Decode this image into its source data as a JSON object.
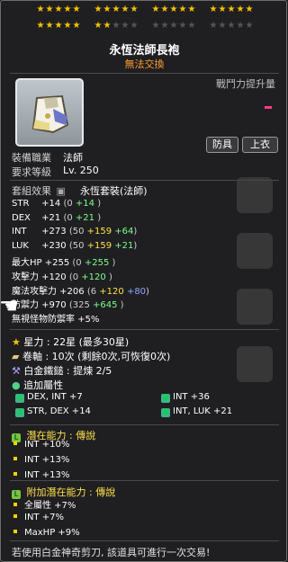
{
  "stars": {
    "row1": [
      5,
      5,
      5,
      5
    ],
    "row2_filled": [
      5,
      2
    ],
    "row2_empty": [
      3,
      5,
      5
    ]
  },
  "item": {
    "name": "永恆法師長袍",
    "untradeable": "無法交換",
    "power_label": "戰鬥力提升量",
    "tag_armor": "防具",
    "tag_top": "上衣",
    "job_label": "裝備職業",
    "job_value": "法師",
    "level_label": "要求等級",
    "level_value": "Lv. 250",
    "set_label": "套組效果",
    "set_value": "永恆套裝(法師)"
  },
  "stats": [
    {
      "name": "STR",
      "base": "+14",
      "open": "(0",
      "p1": "+14",
      "p2": "",
      "close": ")"
    },
    {
      "name": "DEX",
      "base": "+21",
      "open": "(0",
      "p1": "+21",
      "p2": "",
      "close": ")"
    },
    {
      "name": "INT",
      "base": "+273",
      "open": "(50",
      "p1": "+159",
      "p2": "+64",
      "close": ")"
    },
    {
      "name": "LUK",
      "base": "+230",
      "open": "(50",
      "p1": "+159",
      "p2": "+21",
      "close": ")"
    },
    {
      "name": "最大HP",
      "base": "+255",
      "open": "(0",
      "p1": "+255",
      "p2": "",
      "close": ")"
    },
    {
      "name": "攻擊力",
      "base": "+120",
      "open": "(0",
      "p1": "+120",
      "p2": "",
      "close": ")"
    },
    {
      "name": "魔法攻擊力",
      "base": "+206",
      "open": "(6",
      "p1": "+120",
      "p2": "+80",
      "close": ")"
    },
    {
      "name": "防禦力",
      "base": "+970",
      "open": "(325",
      "p1": "+645",
      "p2": "",
      "close": ")"
    },
    {
      "name": "無視怪物防禦率",
      "base": "+5%",
      "open": "",
      "p1": "",
      "p2": "",
      "close": ""
    }
  ],
  "info": {
    "star_force": "星力 : 22星 (最多30星)",
    "scroll": "卷軸 : 10次 (剩餘0次,可恢復0次)",
    "hammer": "白金鐵鎚 : 提煉 2/5",
    "additional": "追加屬性"
  },
  "additional_options": [
    {
      "left_badge": "1",
      "left": "DEX, INT  +7",
      "right_badge": "3",
      "right": "INT  +36"
    },
    {
      "left_badge": "2",
      "left": "STR, DEX  +14",
      "right_badge": "4",
      "right": "INT, LUK  +21"
    }
  ],
  "potential": {
    "title": "潛在能力 : 傳說",
    "lines": [
      "INT +10%",
      "INT +13%",
      "INT +13%"
    ]
  },
  "bonus_potential": {
    "title": "附加潛在能力 : 傳說",
    "lines": [
      "全屬性 +7%",
      "INT +7%",
      "MaxHP +9%"
    ]
  },
  "footer": "若使用白金神奇剪刀, 該道具可進行一次交易!",
  "colors": {
    "star": "#f5c400",
    "green": "#7cff8a",
    "yellow": "#ffe14a",
    "blue": "#8ea8ff",
    "orange": "#ff9b2f"
  }
}
